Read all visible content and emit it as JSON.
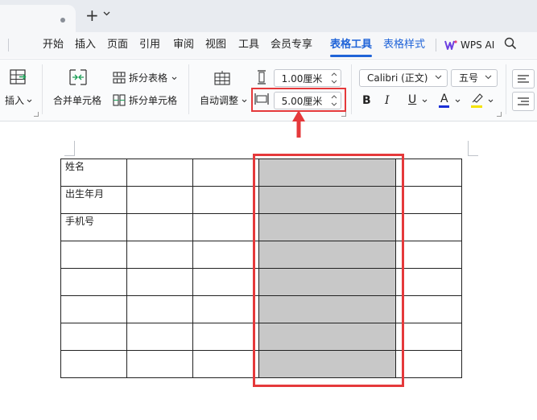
{
  "titlebar": {
    "new_tab_symbol": "+"
  },
  "menu": {
    "items": [
      {
        "label": "开始"
      },
      {
        "label": "插入"
      },
      {
        "label": "页面"
      },
      {
        "label": "引用"
      },
      {
        "label": "审阅"
      },
      {
        "label": "视图"
      },
      {
        "label": "工具"
      },
      {
        "label": "会员专享"
      },
      {
        "label": "表格工具"
      },
      {
        "label": "表格样式"
      }
    ],
    "active_tab": "表格工具",
    "wps_ai_label": "WPS AI",
    "accent_color": "#1f63d8"
  },
  "ribbon": {
    "insert_label": "插入",
    "merge_cells_label": "合并单元格",
    "split_table_label": "拆分表格",
    "split_cells_label": "拆分单元格",
    "auto_fit_label": "自动调整",
    "row_height_value": "1.00厘米",
    "column_width_value": "5.00厘米",
    "font_name": "Calibri (正文)",
    "font_size": "五号"
  },
  "table": {
    "rows": [
      [
        "姓名",
        "",
        "",
        "",
        ""
      ],
      [
        "出生年月",
        "",
        "",
        "",
        ""
      ],
      [
        "手机号",
        "",
        "",
        "",
        ""
      ],
      [
        "",
        "",
        "",
        "",
        ""
      ],
      [
        "",
        "",
        "",
        "",
        ""
      ],
      [
        "",
        "",
        "",
        "",
        ""
      ],
      [
        "",
        "",
        "",
        "",
        ""
      ],
      [
        "",
        "",
        "",
        "",
        ""
      ]
    ],
    "selected_column_index": 3,
    "selection_color": "#c8c8c8"
  },
  "annotation": {
    "highlight_color": "#e5393b"
  }
}
